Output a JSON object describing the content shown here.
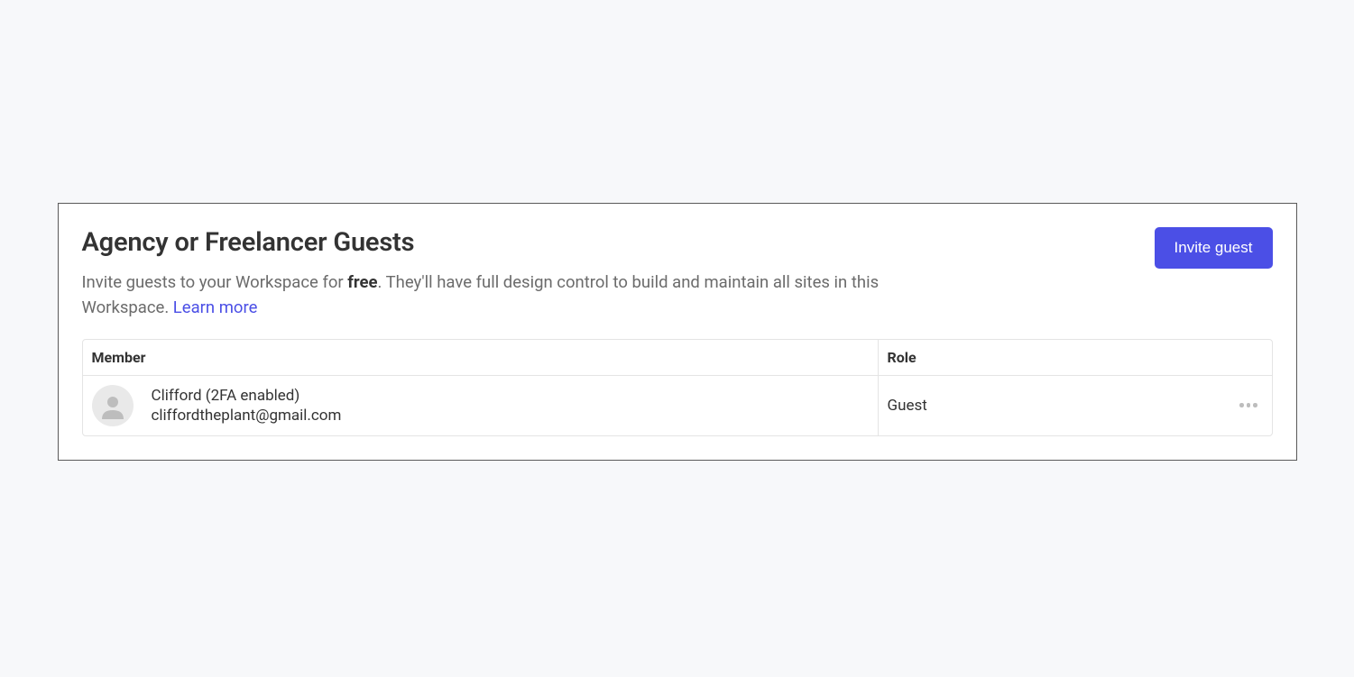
{
  "header": {
    "title": "Agency or Freelancer Guests",
    "description_pre": "Invite guests to your Workspace for ",
    "description_bold": "free",
    "description_post": ". They'll have full design control to build and maintain all sites in this Workspace. ",
    "learn_more": "Learn more",
    "invite_button": "Invite guest"
  },
  "table": {
    "columns": {
      "member": "Member",
      "role": "Role"
    },
    "rows": [
      {
        "name": "Clifford (2FA enabled)",
        "email": "cliffordtheplant@gmail.com",
        "role": "Guest"
      }
    ]
  }
}
